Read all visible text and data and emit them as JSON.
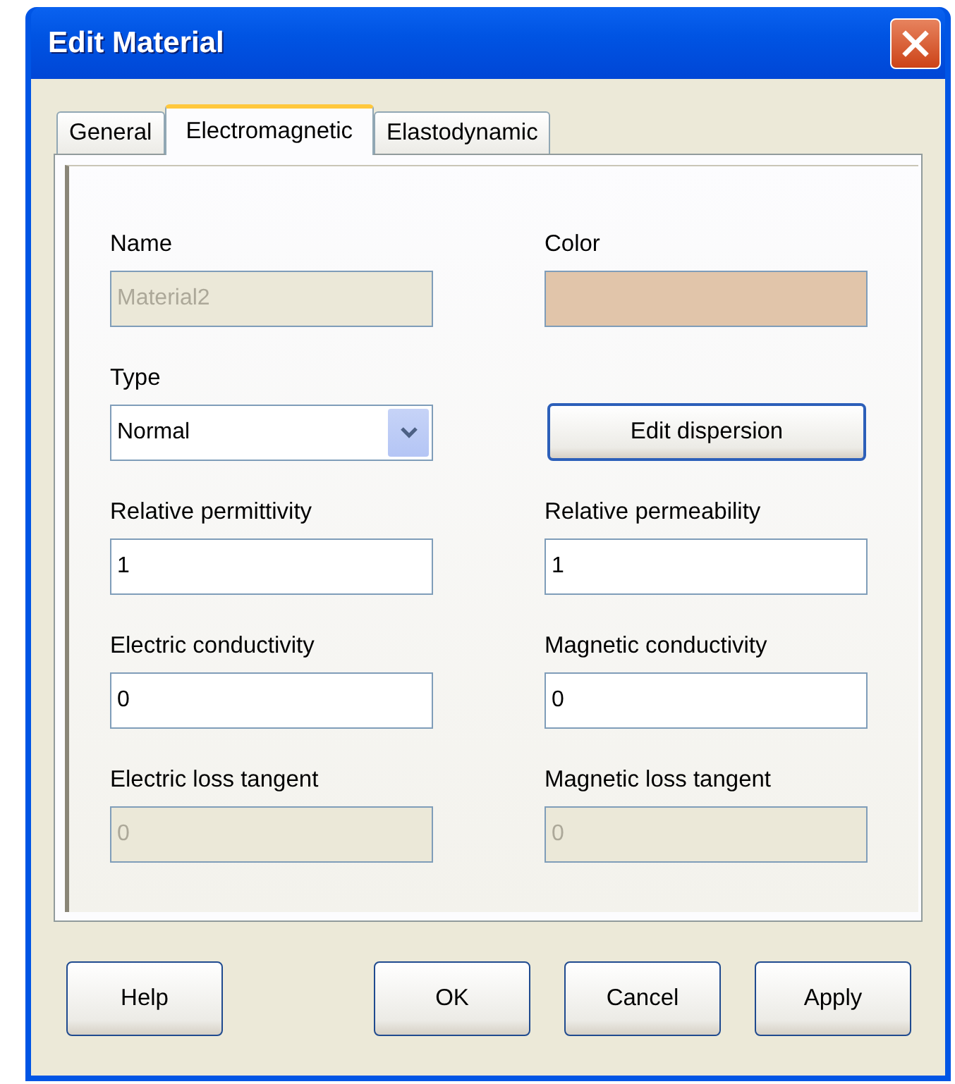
{
  "window": {
    "title": "Edit Material"
  },
  "tabs": [
    {
      "label": "General",
      "selected": false
    },
    {
      "label": "Electromagnetic",
      "selected": true
    },
    {
      "label": "Elastodynamic",
      "selected": false
    }
  ],
  "fields": [
    {
      "kind": "text",
      "label": "Name",
      "value": "Material2",
      "disabled": true
    },
    {
      "kind": "color",
      "label": "Color",
      "color": "#e1c5aa"
    },
    {
      "kind": "dropdown",
      "label": "Type",
      "value": "Normal"
    },
    {
      "kind": "button",
      "label": "Edit dispersion"
    },
    {
      "kind": "text",
      "label": "Relative permittivity",
      "value": "1",
      "disabled": false
    },
    {
      "kind": "text",
      "label": "Relative permeability",
      "value": "1",
      "disabled": false
    },
    {
      "kind": "text",
      "label": "Electric conductivity",
      "value": "0",
      "disabled": false
    },
    {
      "kind": "text",
      "label": "Magnetic conductivity",
      "value": "0",
      "disabled": false
    },
    {
      "kind": "text",
      "label": "Electric loss tangent",
      "value": "0",
      "disabled": true
    },
    {
      "kind": "text",
      "label": "Magnetic loss tangent",
      "value": "0",
      "disabled": true
    }
  ],
  "buttons": [
    "Help",
    "OK",
    "Cancel",
    "Apply"
  ]
}
